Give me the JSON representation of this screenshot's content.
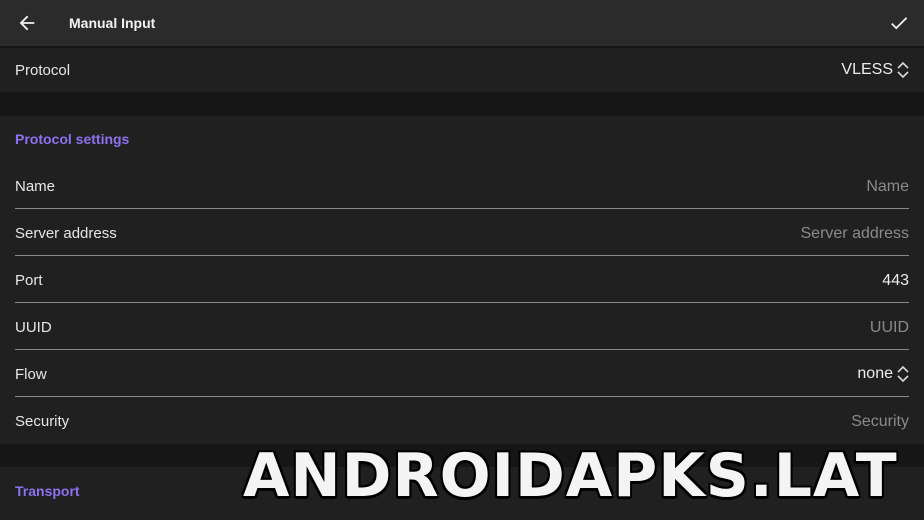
{
  "appbar": {
    "title": "Manual Input",
    "back_icon": "arrow-left-icon",
    "confirm_icon": "check-icon"
  },
  "protocol": {
    "label": "Protocol",
    "value": "VLESS"
  },
  "protocol_settings": {
    "header": "Protocol settings",
    "fields": {
      "name": {
        "label": "Name",
        "placeholder": "Name"
      },
      "server_address": {
        "label": "Server address",
        "placeholder": "Server address"
      },
      "port": {
        "label": "Port",
        "value": "443"
      },
      "uuid": {
        "label": "UUID",
        "placeholder": "UUID"
      },
      "flow": {
        "label": "Flow",
        "value": "none"
      },
      "security": {
        "label": "Security",
        "placeholder": "Security"
      }
    }
  },
  "transport": {
    "header": "Transport"
  },
  "watermark": "ANDROIDAPKS.LAT",
  "colors": {
    "accent": "#8b73f0",
    "appbar": "#2b2b2b",
    "background": "#161616",
    "row": "#202020"
  }
}
